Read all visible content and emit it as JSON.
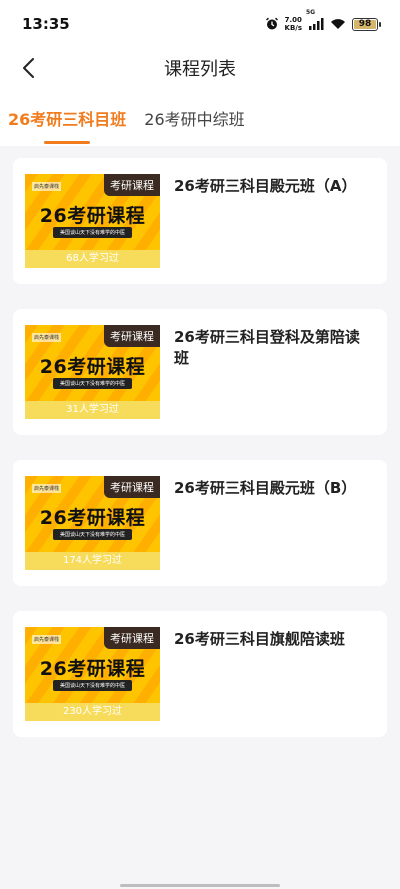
{
  "status": {
    "time": "13:35",
    "net_speed_value": "7.00",
    "net_speed_unit": "KB/s",
    "network": "5G",
    "battery": "98"
  },
  "header": {
    "title": "课程列表"
  },
  "tabs": [
    {
      "label": "26考研三科目班",
      "active": true
    },
    {
      "label": "26考研中综班",
      "active": false
    }
  ],
  "courses": [
    {
      "title": "26考研三科目殿元班（A）",
      "tag": "考研课程",
      "banner": "26考研课程",
      "logo": "启先泰课栈",
      "slogan": "美国谈山天下没有难学的中医",
      "learners": "68人学习过"
    },
    {
      "title": "26考研三科目登科及第陪读班",
      "tag": "考研课程",
      "banner": "26考研课程",
      "logo": "启先泰课栈",
      "slogan": "美国谈山天下没有难学的中医",
      "learners": "31人学习过"
    },
    {
      "title": "26考研三科目殿元班（B）",
      "tag": "考研课程",
      "banner": "26考研课程",
      "logo": "启先泰课栈",
      "slogan": "美国谈山天下没有难学的中医",
      "learners": "174人学习过"
    },
    {
      "title": "26考研三科目旗舰陪读班",
      "tag": "考研课程",
      "banner": "26考研课程",
      "logo": "启先泰课栈",
      "slogan": "美国谈山天下没有难学的中医",
      "learners": "230人学习过"
    }
  ],
  "colors": {
    "accent": "#f07c1e",
    "thumb_bg": "#ffc400",
    "tag_bg": "#3a2a22"
  }
}
